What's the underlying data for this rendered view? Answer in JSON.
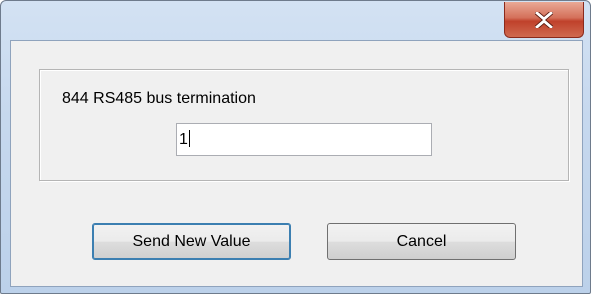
{
  "window": {
    "title": "",
    "close_icon": "close-icon"
  },
  "setting": {
    "label": "844 RS485 bus termination",
    "value": "1"
  },
  "buttons": {
    "send_label": "Send New Value",
    "cancel_label": "Cancel"
  },
  "colors": {
    "close_button": "#c7503a",
    "frame": "#c6d8ee",
    "client": "#f0f0f0"
  }
}
